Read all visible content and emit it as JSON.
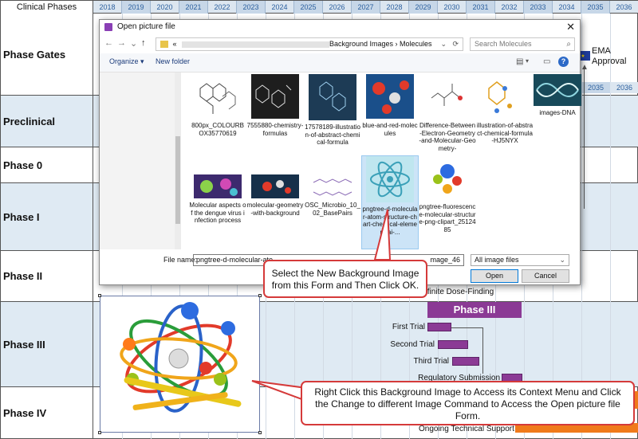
{
  "gantt": {
    "header_label": "Clinical Phases",
    "years": [
      "2018",
      "2019",
      "2020",
      "2021",
      "2022",
      "2023",
      "2024",
      "2025",
      "2026",
      "2027",
      "2028",
      "2029",
      "2030",
      "2031",
      "2032",
      "2033",
      "2034",
      "2035",
      "2036"
    ],
    "phases": [
      "Phase Gates",
      "Preclinical",
      "Phase 0",
      "Phase I",
      "Phase II",
      "Phase III",
      "Phase IV"
    ],
    "second_header_years": [
      "2035",
      "2036"
    ],
    "ema_label": "EMA Approval",
    "phase3_bar_title": "Phase III",
    "tasks": [
      "Definite Dose-Finding",
      "First Trial",
      "Second Trial",
      "Third Trial",
      "Regulatory Submission",
      "Ongoing Technical Support"
    ]
  },
  "dialog": {
    "title": "Open picture file",
    "close": "✕",
    "address": {
      "prefix": "«",
      "crumbs": "Background Images  ›  Molecules",
      "dropdown": "⌄",
      "refresh": "⟳"
    },
    "search_placeholder": "Search Molecules",
    "toolbar": {
      "organize": "Organize ▾",
      "new_folder": "New folder",
      "help": "?"
    },
    "files": [
      {
        "name": "800px_COLOURBOX35770619"
      },
      {
        "name": "7555880-chemistry-formulas"
      },
      {
        "name": "17578189-illustration-of-abstract-chemical-formula"
      },
      {
        "name": "blue-and-red-molecules"
      },
      {
        "name": "Difference-Between-Electron-Geometry-and-Molecular-Geometry-"
      },
      {
        "name": "illustration-of-abstract-chemical-formula-HJ5NYX"
      },
      {
        "name": "images-DNA"
      },
      {
        "name": "Molecular aspects of the dengue virus infection process"
      },
      {
        "name": "molecular-geometry-with-background"
      },
      {
        "name": "OSC_Microbio_10_02_BasePairs"
      },
      {
        "name": "pngtree-d-molecular-atom-structure-chart-chemical-element-ai-..."
      },
      {
        "name": "pngtree-fluorescence-molecular-structure-png-clipart_2512485"
      }
    ],
    "file_name_label": "File name:",
    "file_name_value": "pngtree-d-molecular-ato",
    "file_name_tail": "mage_46",
    "filter": "All image files",
    "open_button": "Open",
    "cancel_button": "Cancel"
  },
  "callouts": {
    "top": "Select the New Background Image from this Form and Then Click OK.",
    "bottom": "Right Click this Background Image to Access its Context Menu and Click the Change to different Image Command to Access the Open picture file Form."
  },
  "colors": {
    "phase_bar": "#8b3a95",
    "callout_border": "#d53a3a",
    "header_tint": "#dce6f0",
    "row_tint": "#dfeaf3",
    "accent_orange": "#f07a1b"
  }
}
